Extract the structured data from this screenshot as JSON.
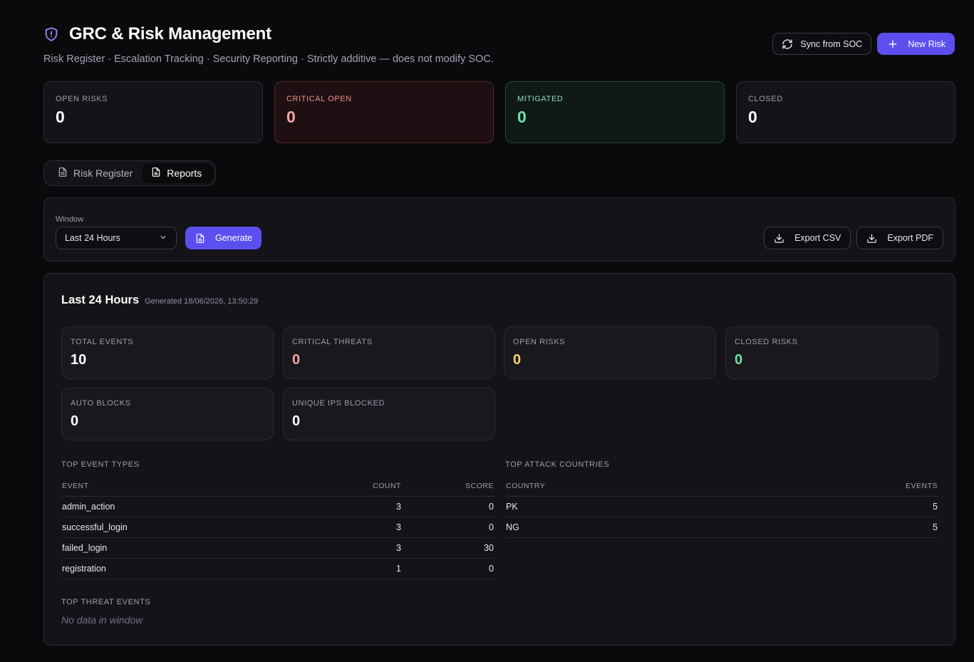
{
  "header": {
    "title": "GRC & Risk Management",
    "subtitle": "Risk Register · Escalation Tracking · Security Reporting · Strictly additive — does not modify SOC.",
    "icon": "shield-alert-icon"
  },
  "actions": {
    "sync_label": "Sync from SOC",
    "new_risk_label": "New Risk"
  },
  "stats": {
    "open": {
      "label": "OPEN RISKS",
      "value": "0"
    },
    "critical": {
      "label": "CRITICAL OPEN",
      "value": "0"
    },
    "mitigated": {
      "label": "MITIGATED",
      "value": "0"
    },
    "closed": {
      "label": "CLOSED",
      "value": "0"
    }
  },
  "tabs": [
    {
      "label": "Risk Register",
      "active": false
    },
    {
      "label": "Reports",
      "active": true
    }
  ],
  "filter": {
    "window_label": "Window",
    "window_value": "Last 24 Hours",
    "generate_label": "Generate",
    "export_csv_label": "Export CSV",
    "export_pdf_label": "Export PDF"
  },
  "report": {
    "title": "Last 24 Hours",
    "generated": "Generated 18/06/2026, 13:50:29",
    "metrics": {
      "total_events": {
        "label": "TOTAL EVENTS",
        "value": "10"
      },
      "critical_threats": {
        "label": "CRITICAL THREATS",
        "value": "0"
      },
      "open_risks": {
        "label": "OPEN RISKS",
        "value": "0"
      },
      "closed_risks": {
        "label": "CLOSED RISKS",
        "value": "0"
      },
      "auto_blocks": {
        "label": "AUTO BLOCKS",
        "value": "0"
      },
      "unique_ips_blocked": {
        "label": "UNIQUE IPS BLOCKED",
        "value": "0"
      }
    },
    "top_event_types": {
      "title": "TOP EVENT TYPES",
      "columns": [
        "EVENT",
        "COUNT",
        "SCORE"
      ],
      "rows": [
        [
          "admin_action",
          "3",
          "0"
        ],
        [
          "successful_login",
          "3",
          "0"
        ],
        [
          "failed_login",
          "3",
          "30"
        ],
        [
          "registration",
          "1",
          "0"
        ]
      ]
    },
    "top_attack_countries": {
      "title": "TOP ATTACK COUNTRIES",
      "columns": [
        "COUNTRY",
        "EVENTS"
      ],
      "rows": [
        [
          "PK",
          "5"
        ],
        [
          "NG",
          "5"
        ]
      ]
    },
    "top_threat_events": {
      "title": "TOP THREAT EVENTS",
      "empty": "No data in window"
    }
  },
  "colors": {
    "accent": "#5b4ff0",
    "critical": "#f4a3a3",
    "warning": "#f6d366",
    "success": "#6be3a6",
    "background": "#0a0a0c"
  }
}
